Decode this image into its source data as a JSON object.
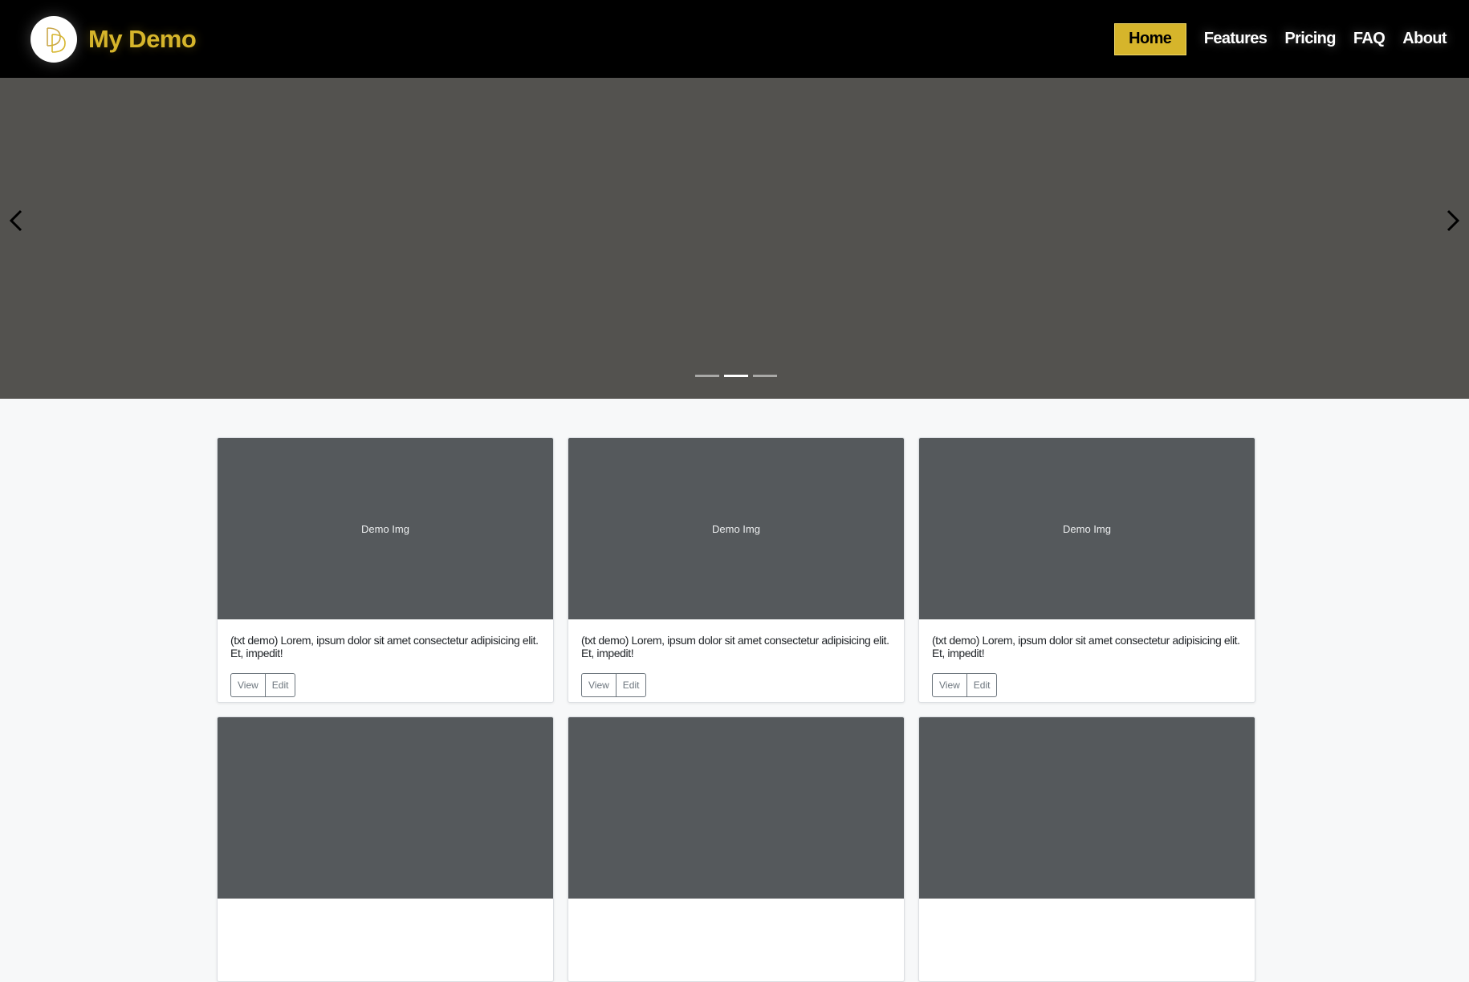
{
  "brand": {
    "name": "My Demo",
    "logo_text": "DD"
  },
  "nav": {
    "items": [
      {
        "label": "Home",
        "active": true
      },
      {
        "label": "Features"
      },
      {
        "label": "Pricing"
      },
      {
        "label": "FAQ"
      },
      {
        "label": "About"
      }
    ]
  },
  "carousel": {
    "slides": 3,
    "active_index": 1,
    "prev_icon": "chevron-left-icon",
    "next_icon": "chevron-right-icon"
  },
  "cards": [
    {
      "image_label": "Demo Img",
      "text": "(txt demo) Lorem, ipsum dolor sit amet consectetur adipisicing elit. Et, impedit!",
      "view_label": "View",
      "edit_label": "Edit"
    },
    {
      "image_label": "Demo Img",
      "text": "(txt demo) Lorem, ipsum dolor sit amet consectetur adipisicing elit. Et, impedit!",
      "view_label": "View",
      "edit_label": "Edit"
    },
    {
      "image_label": "Demo Img",
      "text": "(txt demo) Lorem, ipsum dolor sit amet consectetur adipisicing elit. Et, impedit!",
      "view_label": "View",
      "edit_label": "Edit"
    }
  ],
  "colors": {
    "accent": "#d6b52b",
    "navbar": "#000000",
    "carousel_bg": "#53524f",
    "card_image_bg": "#55595c",
    "page_bg": "#f7f8f9"
  }
}
